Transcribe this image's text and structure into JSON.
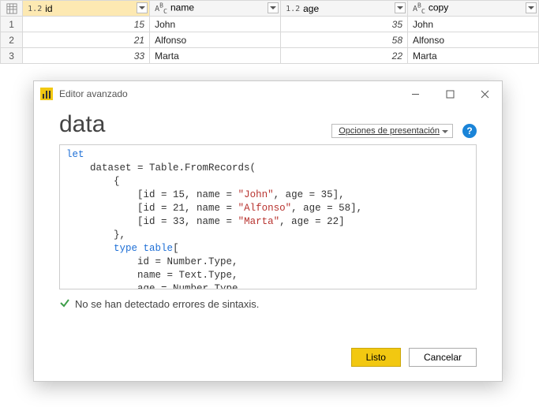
{
  "table": {
    "columns": [
      {
        "type": "1.2",
        "label": "id",
        "selected": true
      },
      {
        "type": "ABC",
        "label": "name",
        "selected": false
      },
      {
        "type": "1.2",
        "label": "age",
        "selected": false
      },
      {
        "type": "ABC",
        "label": "copy",
        "selected": false
      }
    ],
    "rows": [
      {
        "n": "1",
        "id": "15",
        "name": "John",
        "age": "35",
        "copy": "John"
      },
      {
        "n": "2",
        "id": "21",
        "name": "Alfonso",
        "age": "58",
        "copy": "Alfonso"
      },
      {
        "n": "3",
        "id": "33",
        "name": "Marta",
        "age": "22",
        "copy": "Marta"
      }
    ]
  },
  "dialog": {
    "title": "Editor avanzado",
    "heading": "data",
    "options_label": "Opciones de presentación",
    "status": "No se han detectado errores de sintaxis.",
    "ok": "Listo",
    "cancel": "Cancelar"
  },
  "code": {
    "l1_kw": "let",
    "l2": "    dataset = Table.FromRecords(",
    "l3": "        {",
    "l4a": "            [id = ",
    "l4v1": "15",
    "l4b": ", name = ",
    "l4s": "\"John\"",
    "l4c": ", age = ",
    "l4v2": "35",
    "l4d": "],",
    "l5a": "            [id = ",
    "l5v1": "21",
    "l5b": ", name = ",
    "l5s": "\"Alfonso\"",
    "l5c": ", age = ",
    "l5v2": "58",
    "l5d": "],",
    "l6a": "            [id = ",
    "l6v1": "33",
    "l6b": ", name = ",
    "l6s": "\"Marta\"",
    "l6c": ", age = ",
    "l6v2": "22",
    "l6d": "]",
    "l7": "        },",
    "l8a": "        ",
    "l8kw": "type",
    "l8b": " ",
    "l8ty": "table",
    "l8c": "[",
    "l9": "            id = Number.Type,",
    "l10": "            name = Text.Type,",
    "l11": "            age = Number.Type",
    "l12": "        ]"
  }
}
